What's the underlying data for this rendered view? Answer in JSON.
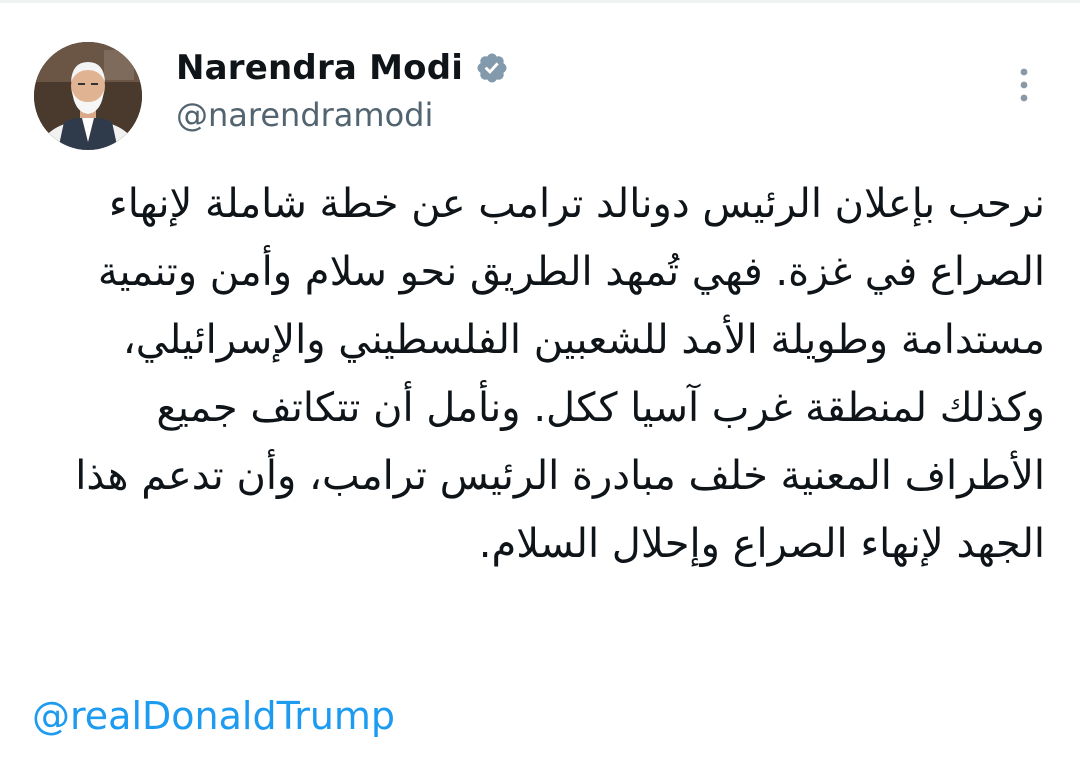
{
  "author": {
    "display_name": "Narendra Modi",
    "handle": "@narendramodi",
    "verified": true,
    "verified_icon": "verified-badge-icon",
    "avatar_icon": "profile-photo"
  },
  "menu": {
    "more_icon": "more-vertical-icon"
  },
  "tweet": {
    "lines": [
      "نرحب بإعلان الرئيس دونالد ترامب عن خطة شاملة لإنهاء",
      "الصراع في غزة. فهي تُمهد الطريق نحو سلام وأمن وتنمية",
      "مستدامة وطويلة الأمد للشعبين الفلسطيني والإسرائيلي،",
      "وكذلك لمنطقة غرب آسيا ككل. ونأمل أن تتكاتف جميع",
      "الأطراف المعنية خلف مبادرة الرئيس ترامب، وأن تدعم هذا",
      "الجهد لإنهاء الصراع وإحلال السلام."
    ],
    "mention": "@realDonaldTrump"
  },
  "colors": {
    "text_primary": "#0f1419",
    "text_secondary": "#536471",
    "link": "#1d9bf0",
    "verified_badge": "#829aab"
  }
}
